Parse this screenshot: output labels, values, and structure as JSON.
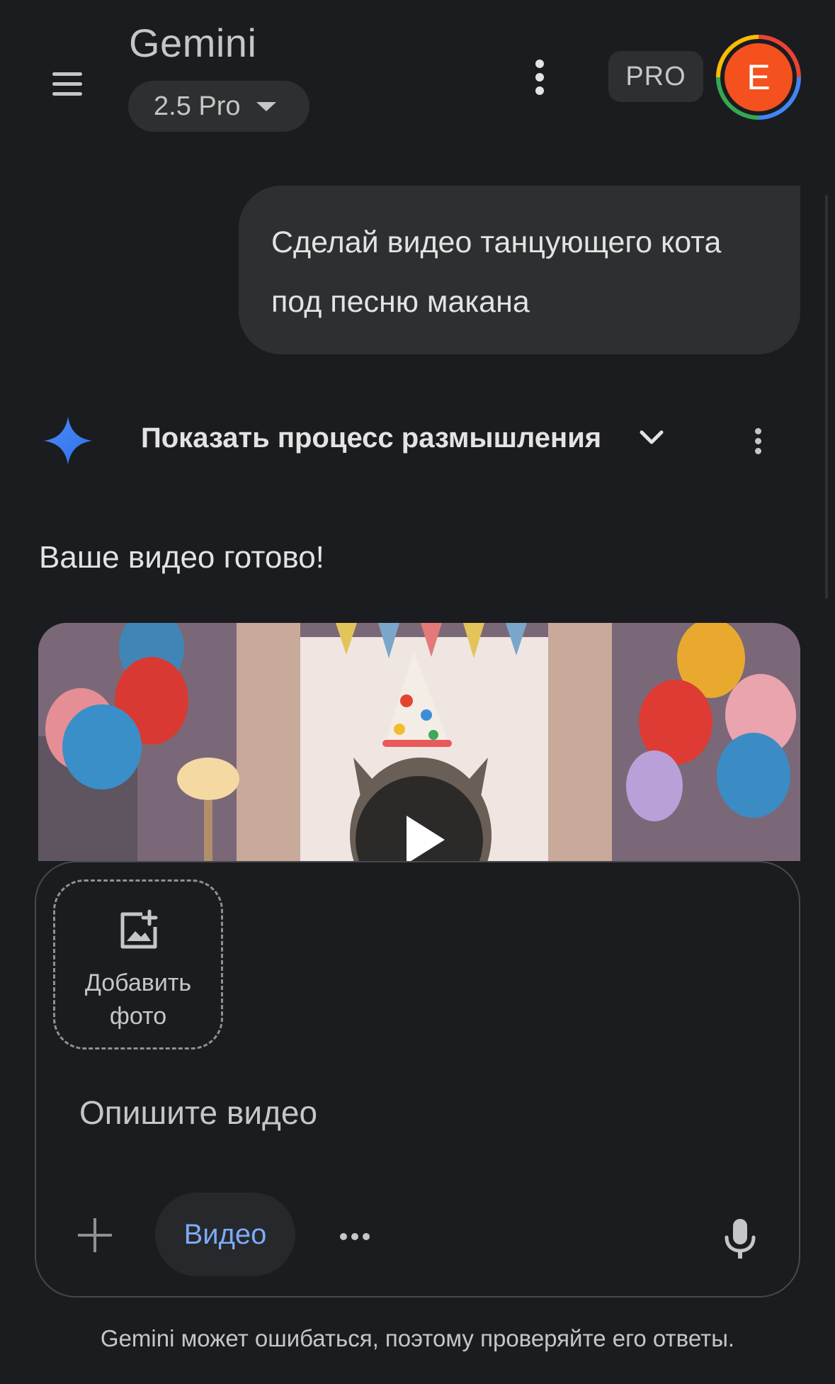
{
  "header": {
    "app_title": "Gemini",
    "model": "2.5 Pro",
    "badge": "PRO",
    "avatar_letter": "E"
  },
  "conversation": {
    "user_message": "Сделай видео танцующего кота под песню макана",
    "thinking_toggle": "Показать процесс размышления",
    "answer_text": "Ваше видео готово!"
  },
  "composer": {
    "add_photo_label": "Добавить фото",
    "placeholder": "Опишите видео",
    "mode_chip": "Видео"
  },
  "footer": {
    "disclaimer": "Gemini может ошибаться, поэтому проверяйте его ответы."
  },
  "colors": {
    "background": "#1b1c1f",
    "accent_blue": "#7cacf8",
    "avatar": "#f4511e"
  }
}
